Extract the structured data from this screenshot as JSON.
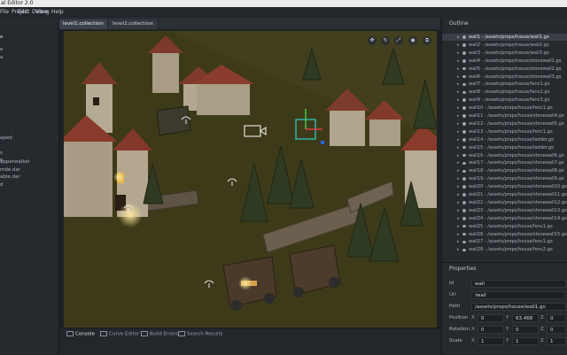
{
  "window": {
    "title": "al Editor 2.0"
  },
  "menu": [
    "File",
    "Edit",
    "View",
    "Project",
    "Debug",
    "Help"
  ],
  "left_panel": {
    "items": [
      "e",
      "e",
      "a",
      "aped",
      "s",
      "e",
      "apperwalkel",
      "mde.dar",
      "able.dar",
      "d"
    ]
  },
  "tabs": [
    {
      "label": "level1.collection",
      "active": true,
      "close": "×"
    },
    {
      "label": "level2.collection",
      "active": false,
      "close": "×"
    }
  ],
  "viewport": {
    "tools": [
      "move-icon",
      "rotate-icon",
      "scale-icon",
      "camera-icon",
      "frame-icon"
    ],
    "tool_glyphs": [
      "✥",
      "↻",
      "⤢",
      "◉",
      "⧉"
    ]
  },
  "bottom_tabs": [
    {
      "label": "Console",
      "active": true
    },
    {
      "label": "Curve Editor",
      "active": false
    },
    {
      "label": "Build Errors",
      "active": false
    },
    {
      "label": "Search Results",
      "active": false
    }
  ],
  "outline": {
    "title": "Outline",
    "items": [
      "wall1 - /assets/props/house/wall1.go",
      "wall2 - /assets/props/house/wall2.go",
      "wall3 - /assets/props/house/wall3.go",
      "wall4 - /assets/props/house/stonewall1.go",
      "wall5 - /assets/props/house/stonewall2.go",
      "wall6 - /assets/props/house/stonewall3.go",
      "wall7 - /assets/props/house/fenc1.go",
      "wall8 - /assets/props/house/fenc2.go",
      "wall9 - /assets/props/house/fenc3.go",
      "wall10 - /assets/props/house/fenc1.go",
      "wall11 - /assets/props/house/stonewall4.go",
      "wall12 - /assets/props/house/stonewall5.go",
      "wall13 - /assets/props/house/fenc1.go",
      "wall14 - /assets/props/house/ladder.go",
      "wall15 - /assets/props/house/ladder.go",
      "wall16 - /assets/props/house/stonewall6.go",
      "wall17 - /assets/props/house/stonewall7.go",
      "wall18 - /assets/props/house/stonewall8.go",
      "wall19 - /assets/props/house/stonewall9.go",
      "wall20 - /assets/props/house/stonewall10.go",
      "wall21 - /assets/props/house/stonewall11.go",
      "wall22 - /assets/props/house/stonewall12.go",
      "wall23 - /assets/props/house/stonewall13.go",
      "wall24 - /assets/props/house/stonewall14.go",
      "wall25 - /assets/props/house/fenc1.go",
      "wall26 - /assets/props/house/stonewall15.go",
      "wall27 - /assets/props/house/fenc1.go",
      "wall28 - /assets/props/house/fenc2.go"
    ]
  },
  "properties": {
    "title": "Properties",
    "id_label": "Id",
    "id_value": "wall",
    "url_label": "Url",
    "url_value": "/wall",
    "path_label": "Path",
    "path_value": "/assets/props/house/wall1.go",
    "position_label": "Position",
    "position": [
      "0",
      "63.468",
      "0"
    ],
    "rotation_label": "Rotation",
    "rotation": [
      "0",
      "0",
      "0"
    ],
    "scale_label": "Scale",
    "scale": [
      "1",
      "1",
      "1"
    ],
    "axes": [
      "X",
      "Y",
      "Z"
    ]
  }
}
